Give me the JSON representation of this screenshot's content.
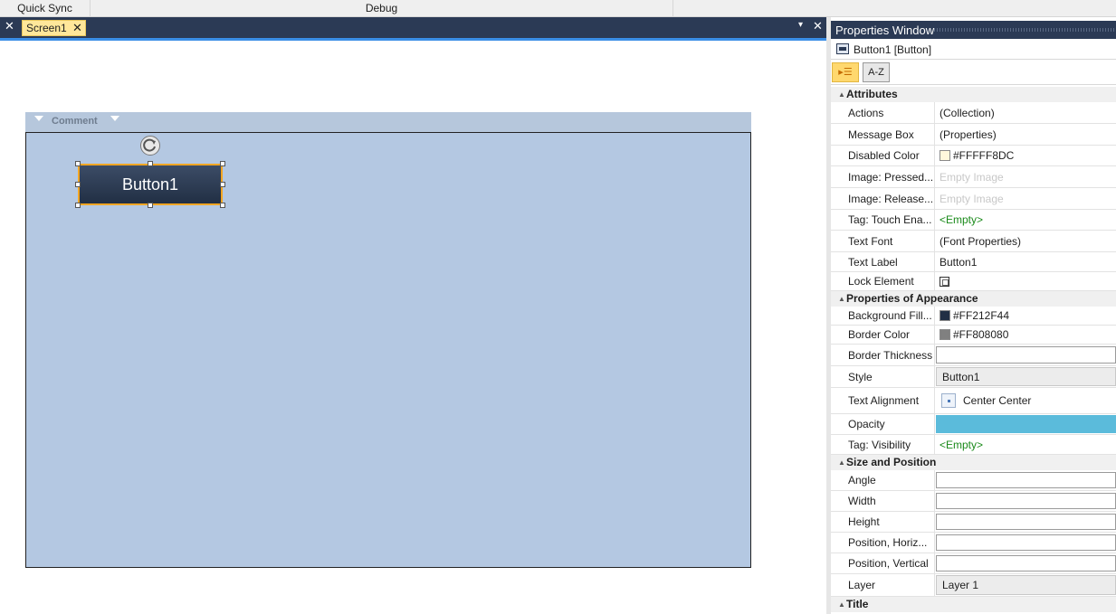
{
  "menu": {
    "quick_sync": "Quick Sync",
    "debug": "Debug"
  },
  "tabs": {
    "close_glyph": "✕",
    "screen_tab": "Screen1",
    "tab_close": "✕",
    "dropdown_glyph": "▾",
    "pane_close": "✕"
  },
  "canvas": {
    "comment_label": "Comment",
    "button_label": "Button1",
    "screen_color": "#B4C8E2"
  },
  "properties": {
    "title": "Properties Window",
    "selected_object": "Button1 [Button]",
    "sort_az": "A-Z",
    "sections": {
      "attributes": "Attributes",
      "appearance": "Properties of Appearance",
      "size_position": "Size and Position",
      "title": "Title"
    },
    "attributes": [
      {
        "name": "Actions",
        "value": "(Collection)"
      },
      {
        "name": "Message Box",
        "value": "(Properties)"
      },
      {
        "name": "Disabled Color",
        "value": "#FFFFF8DC",
        "swatch": "#FFF8DC"
      },
      {
        "name": "Image: Pressed...",
        "value": "Empty Image"
      },
      {
        "name": "Image: Release...",
        "value": "Empty Image"
      },
      {
        "name": "Tag: Touch Ena...",
        "value": "<Empty>"
      },
      {
        "name": "Text Font",
        "value": "(Font Properties)"
      },
      {
        "name": "Text Label",
        "value": "Button1"
      },
      {
        "name": "Lock Element",
        "value": ""
      }
    ],
    "appearance": [
      {
        "name": "Background Fill...",
        "value": "#FF212F44",
        "swatch": "#212F44"
      },
      {
        "name": "Border Color",
        "value": "#FF808080",
        "swatch": "#808080"
      },
      {
        "name": "Border Thickness",
        "value": ""
      },
      {
        "name": "Style",
        "value": "Button1"
      },
      {
        "name": "Text Alignment",
        "value": "Center Center"
      },
      {
        "name": "Opacity",
        "value": ""
      },
      {
        "name": "Tag: Visibility",
        "value": "<Empty>"
      }
    ],
    "size_position": [
      {
        "name": "Angle",
        "value": ""
      },
      {
        "name": "Width",
        "value": ""
      },
      {
        "name": "Height",
        "value": ""
      },
      {
        "name": "Position, Horiz...",
        "value": ""
      },
      {
        "name": "Position, Vertical",
        "value": ""
      },
      {
        "name": "Layer",
        "value": "Layer 1"
      }
    ]
  },
  "colors": {
    "accent_dark": "#2B3A55",
    "selection": "#F3A623",
    "tab_active": "#FFE79A"
  }
}
